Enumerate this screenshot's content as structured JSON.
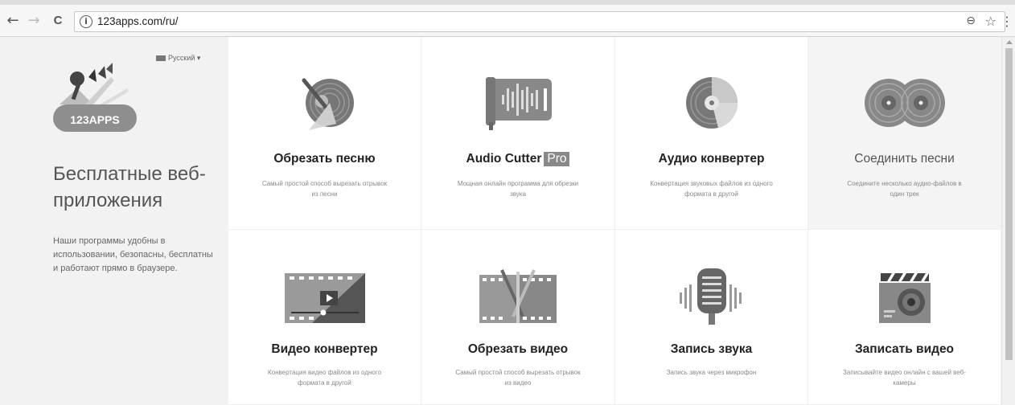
{
  "browser": {
    "url": "123apps.com/ru/",
    "back_glyph": "←",
    "forward_glyph": "→",
    "reload_glyph": "C",
    "info_glyph": "i",
    "zoom_glyph": "🔍",
    "star_glyph": "☆",
    "menu_glyph": "⋮"
  },
  "sidebar": {
    "language": "Русский",
    "logo_text": "123APPS",
    "headline": "Бесплатные веб-приложения",
    "description": "Наши программы удобны в использовании, безопасны, бесплатны и работают прямо в браузере."
  },
  "apps": [
    {
      "title": "Обрезать песню",
      "description": "Самый простой способ вырезать отрывок из песни",
      "icon": "vinyl-cut-icon"
    },
    {
      "title": "Audio Cutter",
      "badge": "Pro",
      "description": "Мощная онлайн программа для обрезки звука",
      "icon": "audio-cutter-pro-icon"
    },
    {
      "title": "Аудио конвертер",
      "description": "Конвертация звуковых файлов из одного формата в другой",
      "icon": "audio-converter-icon"
    },
    {
      "title": "Соединить песни",
      "description": "Соедините несколько аудио-файлов в один трек",
      "icon": "join-songs-icon"
    },
    {
      "title": "Видео конвертер",
      "description": "Конвертация видео файлов из одного формата в другой",
      "icon": "video-converter-icon"
    },
    {
      "title": "Обрезать видео",
      "description": "Самый простой способ вырезать отрывок из видео",
      "icon": "video-cutter-icon"
    },
    {
      "title": "Запись звука",
      "description": "Запись звука через микрофон",
      "icon": "voice-recorder-icon"
    },
    {
      "title": "Записать видео",
      "description": "Записывайте видео онлайн с вашей веб-камеры",
      "icon": "video-recorder-icon"
    }
  ]
}
